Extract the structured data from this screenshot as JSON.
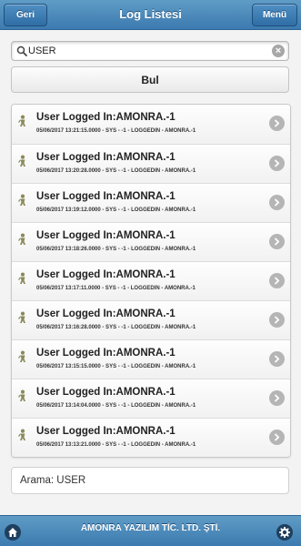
{
  "header": {
    "back_label": "Geri",
    "title": "Log Listesi",
    "menu_label": "Menü"
  },
  "search": {
    "icon": "search-icon",
    "value": "USER",
    "clear_icon": "clear-icon"
  },
  "search_button_label": "Bul",
  "logs": [
    {
      "title": "User Logged In:AMONRA.-1",
      "detail": "05/06/2017 13:21:15.0000 - SYS - -1 - LOGGEDIN - AMONRA.-1"
    },
    {
      "title": "User Logged In:AMONRA.-1",
      "detail": "05/06/2017 13:20:28.0000 - SYS - -1 - LOGGEDIN - AMONRA.-1"
    },
    {
      "title": "User Logged In:AMONRA.-1",
      "detail": "05/06/2017 13:19:12.0000 - SYS - -1 - LOGGEDIN - AMONRA.-1"
    },
    {
      "title": "User Logged In:AMONRA.-1",
      "detail": "05/06/2017 13:18:26.0000 - SYS - -1 - LOGGEDIN - AMONRA.-1"
    },
    {
      "title": "User Logged In:AMONRA.-1",
      "detail": "05/06/2017 13:17:11.0000 - SYS - -1 - LOGGEDIN - AMONRA.-1"
    },
    {
      "title": "User Logged In:AMONRA.-1",
      "detail": "05/06/2017 13:16:28.0000 - SYS - -1 - LOGGEDIN - AMONRA.-1"
    },
    {
      "title": "User Logged In:AMONRA.-1",
      "detail": "05/06/2017 13:15:15.0000 - SYS - -1 - LOGGEDIN - AMONRA.-1"
    },
    {
      "title": "User Logged In:AMONRA.-1",
      "detail": "05/06/2017 13:14:04.0000 - SYS - -1 - LOGGEDIN - AMONRA.-1"
    },
    {
      "title": "User Logged In:AMONRA.-1",
      "detail": "05/06/2017 13:13:21.0000 - SYS - -1 - LOGGEDIN - AMONRA.-1"
    }
  ],
  "result_text": "Arama: USER",
  "footer": {
    "title": "AMONRA YAZILIM TİC. LTD. ŞTİ.",
    "home_icon": "home-icon",
    "settings_icon": "gear-icon"
  },
  "colors": {
    "bar": "#3c7ab0",
    "icon_grey": "#b5b5b5",
    "login_icon": "#8a8a5a"
  }
}
